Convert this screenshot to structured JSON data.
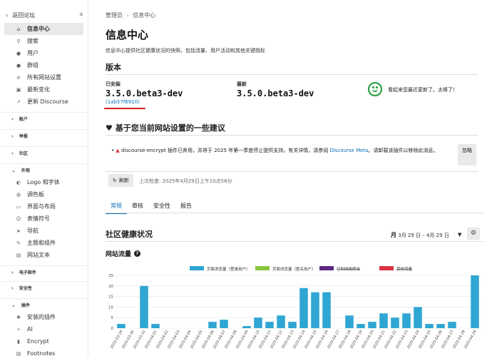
{
  "sidebar": {
    "back": "返回论坛",
    "items": [
      {
        "label": "信息中心",
        "icon": "home-icon"
      },
      {
        "label": "搜索",
        "icon": "search-icon"
      },
      {
        "label": "用户",
        "icon": "user-icon"
      },
      {
        "label": "群组",
        "icon": "users-icon"
      },
      {
        "label": "所有网站设置",
        "icon": "sliders-icon"
      },
      {
        "label": "最新变化",
        "icon": "gift-icon"
      },
      {
        "label": "更新 Discourse",
        "icon": "rocket-icon"
      }
    ],
    "sections": {
      "account": "账户",
      "reports": "举报",
      "community": "社区",
      "appearance": "外观",
      "email": "电子邮件",
      "security": "安全性",
      "plugins": "插件"
    },
    "appearance_items": [
      {
        "label": "Logo 和字体",
        "icon": "palette-icon"
      },
      {
        "label": "调色板",
        "icon": "paint-icon"
      },
      {
        "label": "界面与布局",
        "icon": "layout-icon"
      },
      {
        "label": "表情符号",
        "icon": "smile-icon"
      },
      {
        "label": "导航",
        "icon": "nav-icon"
      },
      {
        "label": "主题和组件",
        "icon": "brush-icon"
      },
      {
        "label": "网站文本",
        "icon": "text-icon"
      }
    ],
    "plugin_items": [
      {
        "label": "安装的插件",
        "icon": "puzzle-icon"
      },
      {
        "label": "AI",
        "icon": "ai-icon"
      },
      {
        "label": "Encrypt",
        "icon": "lock-icon"
      },
      {
        "label": "Footnotes",
        "icon": "footnote-icon"
      }
    ]
  },
  "breadcrumb": {
    "root": "管理员",
    "sep": "›",
    "current": "信息中心"
  },
  "page": {
    "title": "信息中心",
    "description": "信息中心提供社区健康状况的快照，包括流量、用户活动和其他关键指标"
  },
  "version": {
    "title": "版本",
    "installed_label": "已安装",
    "installed": "3.5.0.beta3-dev",
    "commit": "(1ab57f6910)",
    "latest_label": "最新",
    "latest": "3.5.0.beta3-dev",
    "status": "看起来您最近更新了。太棒了！"
  },
  "suggestions": {
    "title": "基于您当前网站设置的一些建议",
    "text_before": "discourse-encrypt 插件已弃用，并将于 2025 年第一季度停止提供支持。有关详情，请参阅 ",
    "link": "Discourse Meta",
    "text_after": "。请卸载该插件以移除此消息。",
    "ignore_label": "忽略",
    "refresh_label": "刷新",
    "last_checked": "上次检查: 2025年4月29日上午10点58分"
  },
  "tabs": [
    "常规",
    "审核",
    "安全性",
    "报告"
  ],
  "health": {
    "title": "社区健康状况",
    "date_prefix": "月",
    "date_range": "3月 29 日 – 4月 29 日"
  },
  "traffic": {
    "title": "网站流量",
    "help": "?"
  },
  "colors": {
    "bar": "#2fa6d3",
    "green": "#8ac43f",
    "purple": "#5c2a83",
    "red": "#d93343"
  },
  "chart_data": {
    "type": "bar",
    "categories": [
      "2025-03-29",
      "2025-03-30",
      "2025-03-31",
      "2025-04-01",
      "2025-04-02",
      "2025-04-03",
      "2025-04-04",
      "2025-04-05",
      "2025-04-06",
      "2025-04-07",
      "2025-04-08",
      "2025-04-09",
      "2025-04-10",
      "2025-04-11",
      "2025-04-12",
      "2025-04-13",
      "2025-04-14",
      "2025-04-15",
      "2025-04-16",
      "2025-04-17",
      "2025-04-18",
      "2025-04-19",
      "2025-04-20",
      "2025-04-21",
      "2025-04-22",
      "2025-04-23",
      "2025-04-24",
      "2025-04-25",
      "2025-04-26",
      "2025-04-27",
      "2025-04-28",
      "2025-04-29"
    ],
    "series": [
      {
        "name": "页面浏览量（登录用户）",
        "color": "#2fa6d3",
        "values": [
          2,
          0,
          20,
          2,
          0,
          0,
          0,
          0,
          3,
          4,
          0,
          1,
          5,
          3,
          6,
          3,
          19,
          17,
          17,
          0,
          6,
          2,
          3,
          7,
          5,
          7,
          10,
          2,
          2,
          3,
          0,
          25
        ]
      },
      {
        "name": "页面浏览量（匿名用户）",
        "color": "#8ac43f",
        "values": []
      },
      {
        "name": "已知网络爬虫",
        "color": "#5c2a83",
        "values": []
      },
      {
        "name": "其他流量",
        "color": "#d93343",
        "values": []
      }
    ],
    "yticks": [
      0,
      5,
      10,
      15,
      20,
      25
    ],
    "ylim": [
      0,
      25
    ],
    "legend": "top"
  }
}
